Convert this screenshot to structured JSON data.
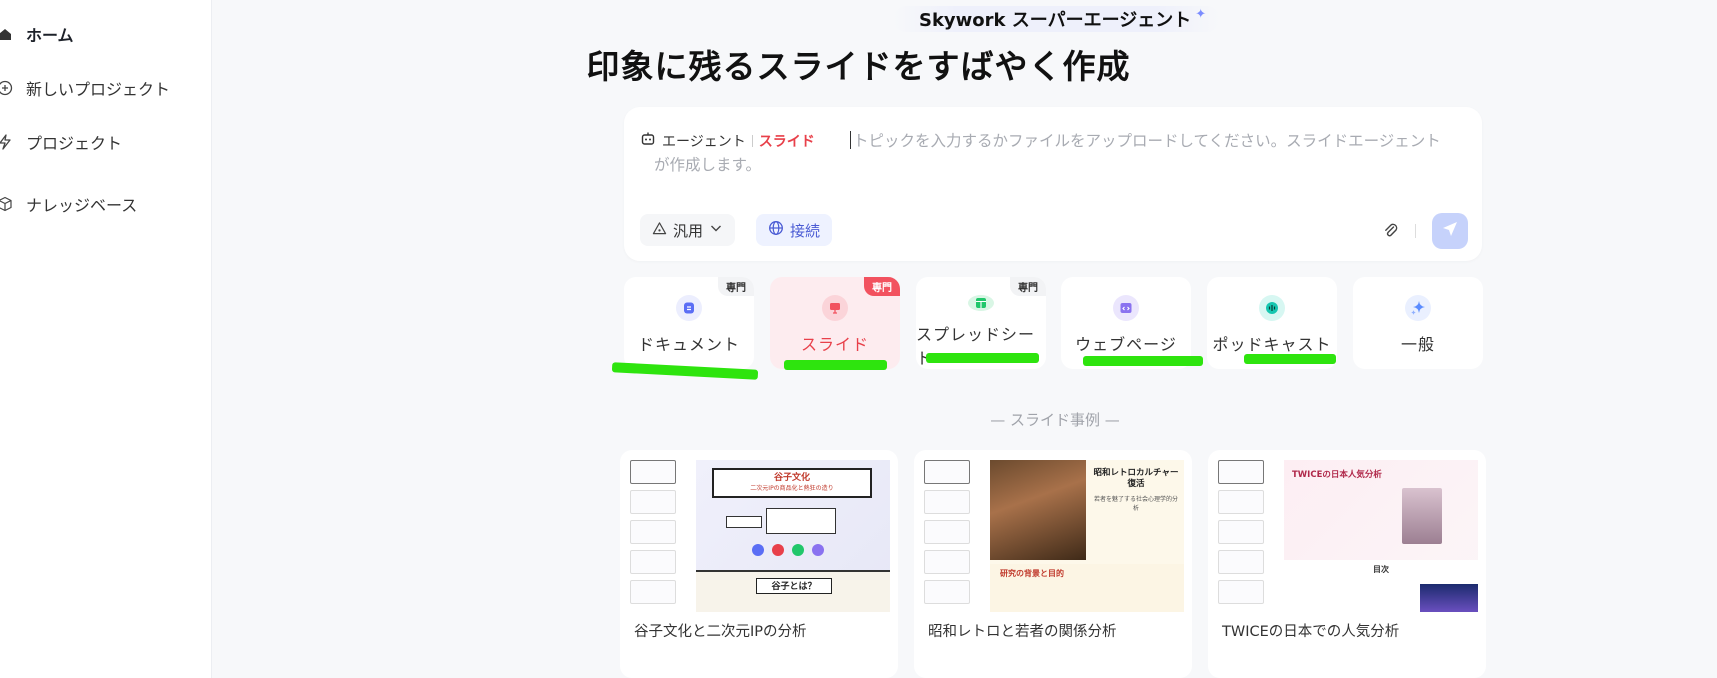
{
  "sidebar": {
    "items": [
      {
        "label": "ホーム",
        "icon": "home-icon"
      },
      {
        "label": "新しいプロジェクト",
        "icon": "plus-circle-icon"
      },
      {
        "label": "プロジェクト",
        "icon": "lightning-icon"
      },
      {
        "label": "ナレッジベース",
        "icon": "cube-icon"
      }
    ]
  },
  "header": {
    "badge": "Skywork スーパーエージェント",
    "title": "印象に残るスライドをすばやく作成"
  },
  "input": {
    "agent_label": "エージェント",
    "mode_label": "スライド",
    "placeholder": "トピックを入力するかファイルをアップロードしてください。スライドエージェントが作成します。",
    "general_button": "汎用",
    "connect_button": "接続"
  },
  "types": [
    {
      "label": "ドキュメント",
      "badge": "専門",
      "icon": "document-icon",
      "color": "#5b6ef5"
    },
    {
      "label": "スライド",
      "badge": "専門",
      "icon": "presentation-icon",
      "color": "#f2525f",
      "selected": true
    },
    {
      "label": "スプレッドシート",
      "badge": "専門",
      "icon": "spreadsheet-icon",
      "color": "#21c76b"
    },
    {
      "label": "ウェブページ",
      "badge": "",
      "icon": "webpage-icon",
      "color": "#8a72f0"
    },
    {
      "label": "ポッドキャスト",
      "badge": "",
      "icon": "podcast-icon",
      "color": "#16c6b0"
    },
    {
      "label": "一般",
      "badge": "",
      "icon": "sparkle-icon",
      "color": "#5b8cff"
    }
  ],
  "examples": {
    "section_title": "スライド事例",
    "items": [
      {
        "title": "谷子文化と二次元IPの分析",
        "preview_heading": "谷子文化",
        "preview_sub": "二次元IPの商品化と熱狂の造り",
        "preview_heading2": "谷子とは？"
      },
      {
        "title": "昭和レトロと若者の関係分析",
        "preview_heading": "昭和レトロカルチャー復活",
        "preview_sub": "若者を魅了する社会心理学的分析",
        "preview_heading2": "研究の背景と目的"
      },
      {
        "title": "TWICEの日本での人気分析",
        "preview_heading": "TWICEの日本人気分析",
        "preview_sub": "",
        "preview_heading2": "目次"
      }
    ]
  }
}
